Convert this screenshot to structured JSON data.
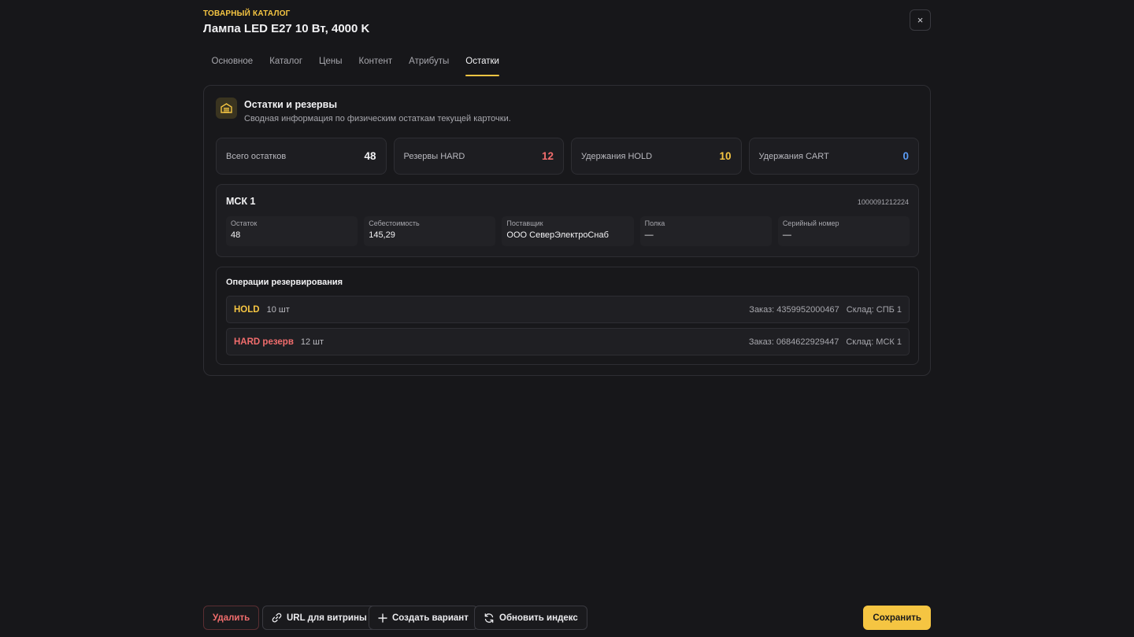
{
  "header": {
    "eyebrow": "ТОВАРНЫЙ КАТАЛОГ",
    "title": "Лампа LED E27 10 Вт, 4000 K",
    "close_label": "×"
  },
  "tabs": [
    {
      "label": "Основное",
      "active": false
    },
    {
      "label": "Каталог",
      "active": false
    },
    {
      "label": "Цены",
      "active": false
    },
    {
      "label": "Контент",
      "active": false
    },
    {
      "label": "Атрибуты",
      "active": false
    },
    {
      "label": "Остатки",
      "active": true
    }
  ],
  "section": {
    "icon": "warehouse-icon",
    "title": "Остатки и резервы",
    "subtitle": "Сводная информация по физическим остаткам текущей карточки."
  },
  "stats": [
    {
      "label": "Всего остатков",
      "value": "48",
      "color": "#f2f2f4"
    },
    {
      "label": "Резервы HARD",
      "value": "12",
      "color": "#f26d6d"
    },
    {
      "label": "Удержания HOLD",
      "value": "10",
      "color": "#f5c542"
    },
    {
      "label": "Удержания CART",
      "value": "0",
      "color": "#5b9cf5"
    }
  ],
  "warehouse": {
    "name": "МСК 1",
    "code": "1000091212224",
    "fields": [
      {
        "label": "Остаток",
        "value": "48"
      },
      {
        "label": "Себестоимость",
        "value": "145,29"
      },
      {
        "label": "Поставщик",
        "value": "ООО СеверЭлектроСнаб"
      },
      {
        "label": "Полка",
        "value": "—"
      },
      {
        "label": "Серийный номер",
        "value": "—"
      }
    ]
  },
  "operations": {
    "title": "Операции резервирования",
    "rows": [
      {
        "type": "HOLD",
        "color": "#f5c542",
        "qty": "10 шт",
        "order": "Заказ: 4359952000467",
        "warehouse": "Склад: СПБ 1"
      },
      {
        "type": "HARD резерв",
        "color": "#f26d6d",
        "qty": "12 шт",
        "order": "Заказ: 0684622929447",
        "warehouse": "Склад: МСК 1"
      }
    ]
  },
  "footer": {
    "delete_label": "Удалить",
    "url_label": "URL для витрины",
    "create_variant_label": "Создать вариант",
    "refresh_index_label": "Обновить индекс",
    "save_label": "Сохранить"
  },
  "colors": {
    "accent": "#f5c542",
    "danger": "#f26d6d",
    "info": "#5b9cf5",
    "background": "#17171a"
  }
}
